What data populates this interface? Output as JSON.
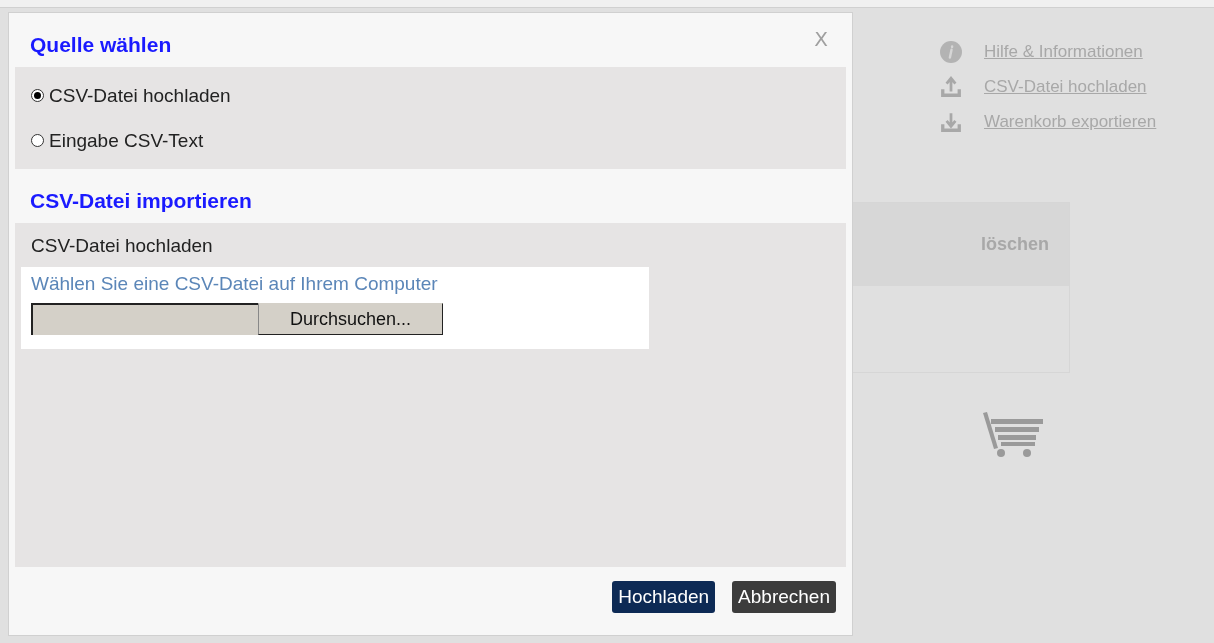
{
  "dialog": {
    "close": "X",
    "sections": [
      {
        "kind": "radios",
        "title": "Quelle wählen",
        "options": [
          {
            "label": "CSV-Datei hochladen",
            "selected": true
          },
          {
            "label": "Eingabe CSV-Text",
            "selected": false
          }
        ]
      },
      {
        "kind": "upload",
        "title": "CSV-Datei importieren",
        "label": "CSV-Datei hochladen",
        "hint": "Wählen Sie eine CSV-Datei auf Ihrem Computer",
        "browse": "Durchsuchen..."
      }
    ],
    "buttons": [
      {
        "kind": "primary",
        "label": "Hochladen"
      },
      {
        "kind": "secondary",
        "label": "Abbrechen"
      }
    ]
  },
  "page": {
    "links": [
      {
        "kind": "info",
        "label": "Hilfe & Informationen"
      },
      {
        "kind": "upload",
        "label": "CSV-Datei hochladen"
      },
      {
        "kind": "download",
        "label": "Warenkorb exportieren"
      }
    ],
    "table": {
      "columns": [
        "löschen"
      ]
    }
  }
}
